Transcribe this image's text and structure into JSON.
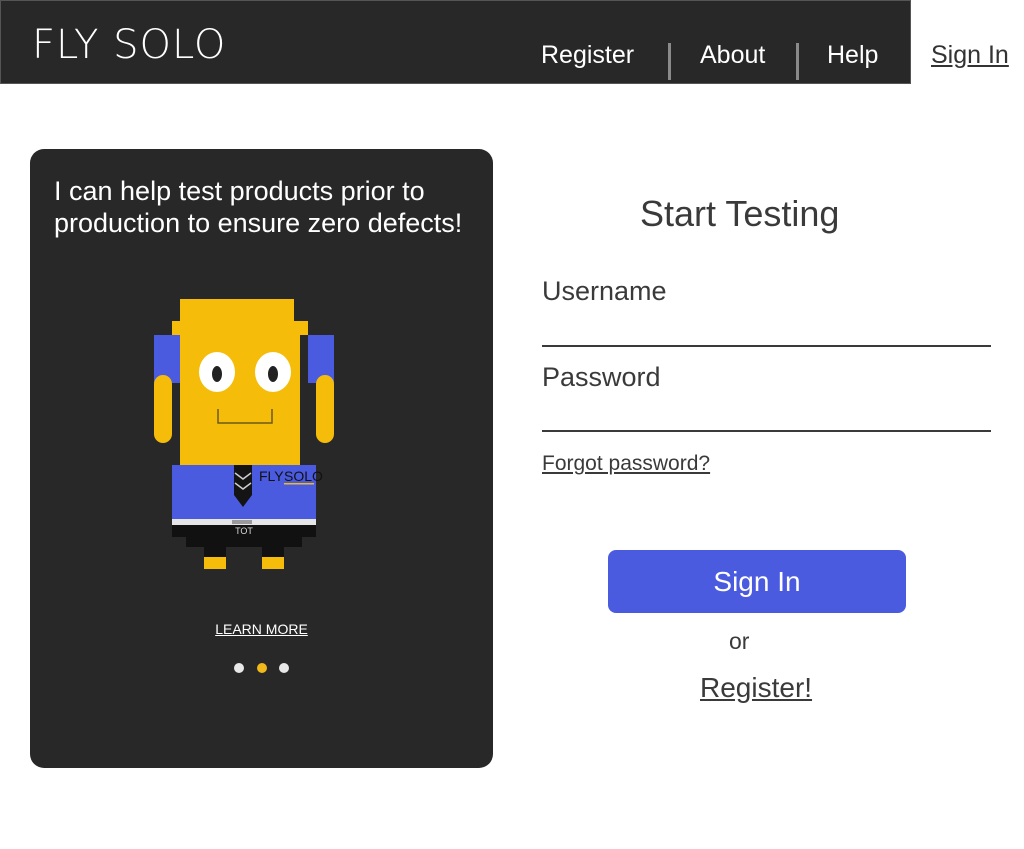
{
  "header": {
    "logo_fly": "FLY",
    "logo_solo": "SOLO",
    "nav": [
      {
        "label": "Register"
      },
      {
        "label": "About"
      },
      {
        "label": "Help"
      }
    ],
    "signin_link": "Sign In",
    "background_color": "#282828",
    "accent_color": "#f1b91a"
  },
  "card": {
    "text": "I can help test products prior to production to ensure zero defects!",
    "robot": {
      "tie_logo_fly": "FLY",
      "tie_logo_solo": "SOLO",
      "belt_text": "TOT"
    },
    "learn_more": "LEARN MORE",
    "carousel": {
      "count": 3,
      "active_index": 1
    }
  },
  "form": {
    "title": "Start Testing",
    "username_label": "Username",
    "username_value": "",
    "password_label": "Password",
    "password_value": "",
    "forgot_password": "Forgot password?",
    "signin_button": "Sign In",
    "or_text": "or",
    "register_link": "Register!",
    "button_color": "#4b5bdf"
  }
}
